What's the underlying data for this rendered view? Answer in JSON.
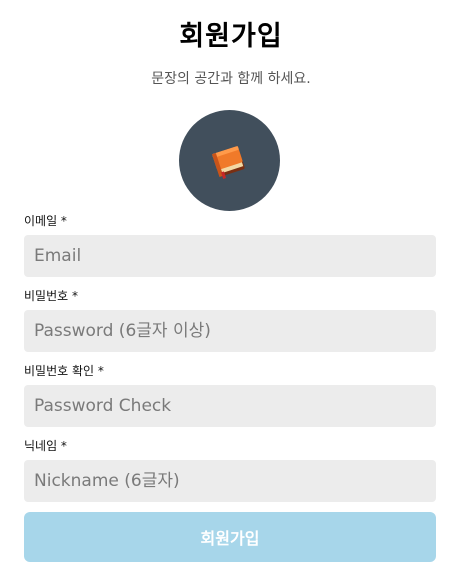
{
  "header": {
    "title": "회원가입",
    "subtitle": "문장의 공간과 함께 하세요."
  },
  "avatar": {
    "icon": "book-icon"
  },
  "form": {
    "email": {
      "label": "이메일 *",
      "placeholder": "Email"
    },
    "password": {
      "label": "비밀번호 *",
      "placeholder": "Password (6글자 이상)"
    },
    "password_check": {
      "label": "비밀번호 확인 *",
      "placeholder": "Password Check"
    },
    "nickname": {
      "label": "닉네임 *",
      "placeholder": "Nickname (6글자)"
    },
    "submit_label": "회원가입"
  },
  "colors": {
    "input_bg": "#ececec",
    "avatar_bg": "#414f5c",
    "button_bg": "#a7d6ea",
    "button_text": "#ffffff"
  }
}
